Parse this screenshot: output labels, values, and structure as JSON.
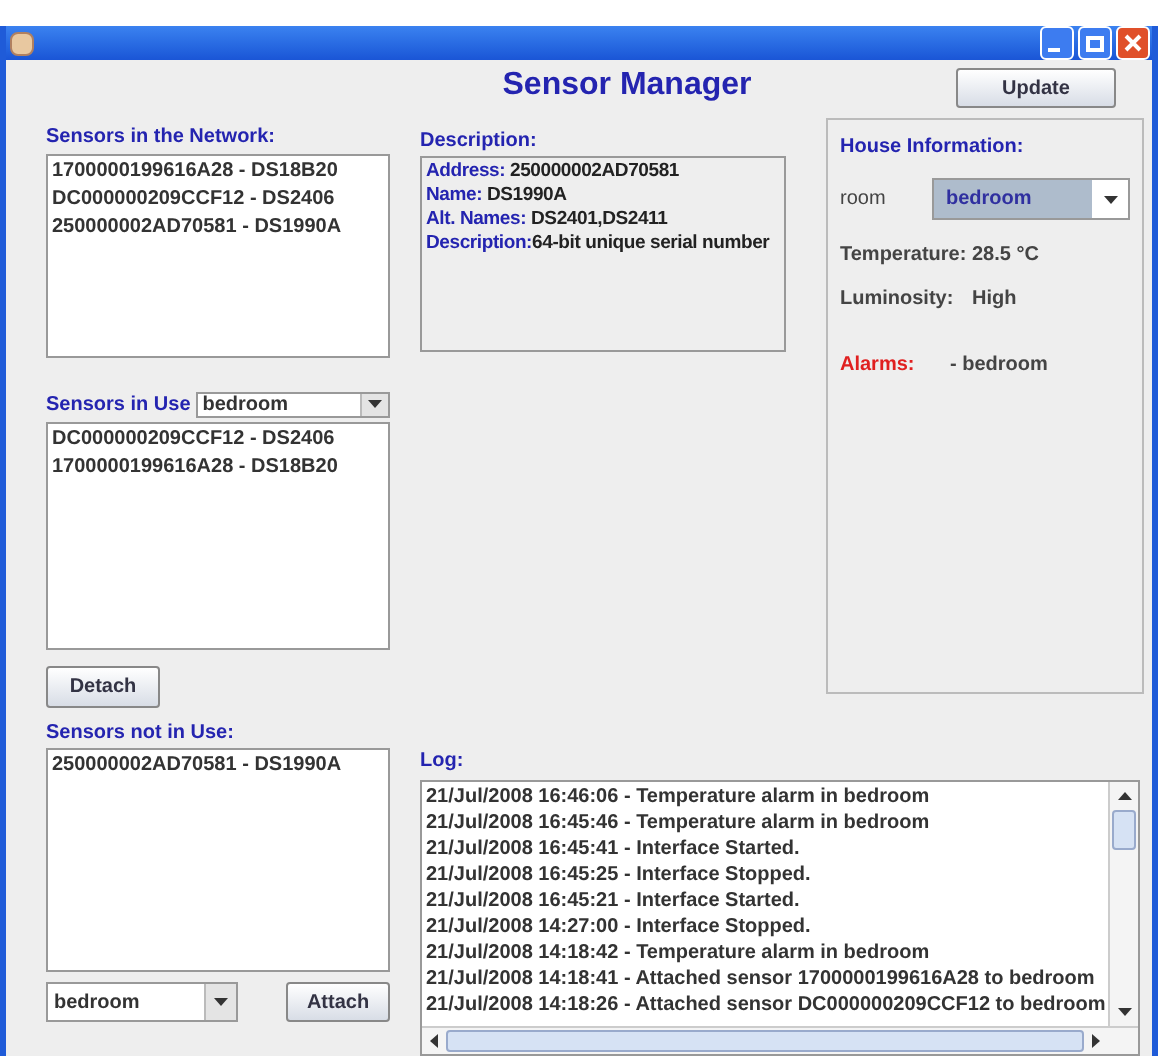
{
  "heading": "Sensor Manager",
  "update_button": "Update",
  "network_sensors": {
    "label": "Sensors in the Network:",
    "items": [
      "1700000199616A28 - DS18B20",
      "DC000000209CCF12 - DS2406",
      "250000002AD70581 - DS1990A"
    ]
  },
  "description": {
    "label": "Description:",
    "fields": [
      {
        "label": "Address:",
        "value": " 250000002AD70581"
      },
      {
        "label": "Name:",
        "value": " DS1990A"
      },
      {
        "label": "Alt. Names:",
        "value": " DS2401,DS2411"
      },
      {
        "label": "Description:",
        "value": "64-bit unique serial number"
      }
    ]
  },
  "house_information": {
    "label": "House Information:",
    "room": {
      "label": "room",
      "value": "bedroom"
    },
    "readings": [
      {
        "label": "Temperature:",
        "value": "28.5 °C"
      },
      {
        "label": "Luminosity:",
        "value": "High"
      }
    ],
    "alarms": {
      "label": "Alarms:",
      "value": "- bedroom"
    }
  },
  "sensors_in_use": {
    "label": "Sensors in Use",
    "room_select": "bedroom",
    "items": [
      "DC000000209CCF12 - DS2406",
      "1700000199616A28 - DS18B20"
    ]
  },
  "detach_button": "Detach",
  "sensors_not_in_use": {
    "label": "Sensors not in Use:",
    "items": [
      "250000002AD70581 - DS1990A"
    ],
    "room_select": "bedroom",
    "attach_button": "Attach"
  },
  "log": {
    "label": "Log:",
    "entries": [
      "21/Jul/2008 16:46:06 - Temperature alarm in bedroom",
      "21/Jul/2008 16:45:46 - Temperature alarm in bedroom",
      "21/Jul/2008 16:45:41 - Interface Started.",
      "21/Jul/2008 16:45:25 - Interface Stopped.",
      "21/Jul/2008 16:45:21 - Interface Started.",
      "21/Jul/2008 14:27:00 - Interface Stopped.",
      "21/Jul/2008 14:18:42 - Temperature alarm in bedroom",
      "21/Jul/2008 14:18:41 - Attached sensor 1700000199616A28 to bedroom",
      "21/Jul/2008 14:18:26 - Attached sensor DC000000209CCF12 to bedroom"
    ]
  }
}
